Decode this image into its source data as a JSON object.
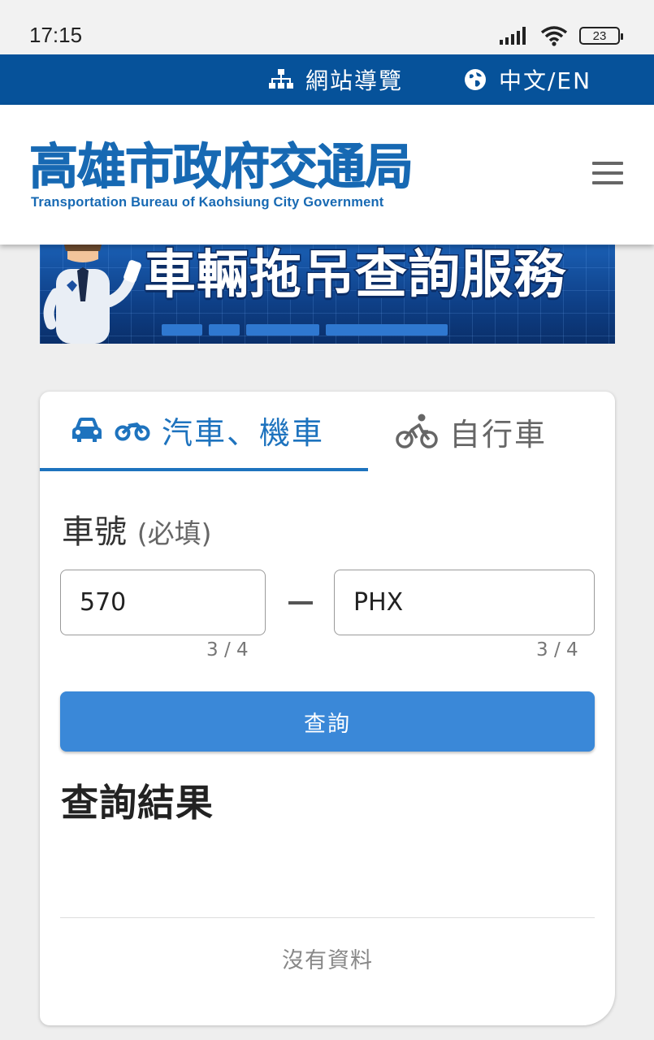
{
  "status_bar": {
    "time": "17:15",
    "battery": "23"
  },
  "top_bar": {
    "sitemap_label": "網站導覽",
    "language_label": "中文/EN"
  },
  "header": {
    "logo_cn": "高雄市政府交通局",
    "logo_en": "Transportation Bureau of Kaohsiung City Government"
  },
  "banner": {
    "title": "車輛拖吊查詢服務"
  },
  "tabs": [
    {
      "label": "汽車、機車",
      "active": true
    },
    {
      "label": "自行車",
      "active": false
    }
  ],
  "form": {
    "label": "車號",
    "required_note": "(必填)",
    "plate_part1": "570",
    "plate_part2": "PHX",
    "counter_part1": "3 / 4",
    "counter_part2": "3 / 4",
    "separator": "—",
    "submit_label": "查詢"
  },
  "results": {
    "title": "查詢結果",
    "empty_text": "沒有資料"
  },
  "colors": {
    "brand_blue": "#06529a",
    "tab_blue": "#1e73be",
    "button_blue": "#3a88d8"
  }
}
